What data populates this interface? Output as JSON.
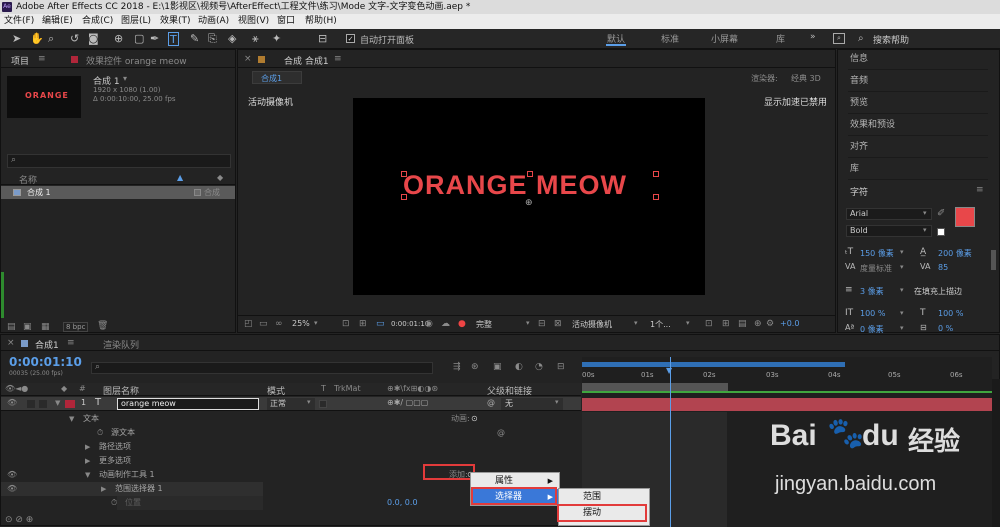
{
  "window": {
    "title": "Adobe After Effects CC 2018 - E:\\1影视区\\视频号\\AfterEffect\\工程文件\\练习\\Mode 文字-文字变色动画.aep *",
    "logo": "Ae"
  },
  "menu": [
    "文件(F)",
    "编辑(E)",
    "合成(C)",
    "图层(L)",
    "效果(T)",
    "动画(A)",
    "视图(V)",
    "窗口",
    "帮助(H)"
  ],
  "toolbar": {
    "auto_open_label": "自动打开面板",
    "search_placeholder": "搜索帮助"
  },
  "workspaces": [
    "默认",
    "标准",
    "小屏幕",
    "库"
  ],
  "project_panel": {
    "tab_project": "项目",
    "tab_effects": "效果控件 orange meow",
    "thumb_text": "ORANGE",
    "comp_name": "合成 1",
    "comp_info_1": "1920 x 1080 (1.00)",
    "comp_info_2": "Δ 0:00:10:00, 25.00 fps",
    "col_name": "名称",
    "item_name": "合成 1",
    "item_type": "合成",
    "bpc": "8 bpc"
  },
  "comp_viewer": {
    "tab": "合成 合成1",
    "breadcrumb": "合成1",
    "renderer_label": "渲染器:",
    "renderer_value": "经典 3D",
    "camera_label": "活动摄像机",
    "accel_label": "显示加速已禁用",
    "canvas_text": "ORANGE MEOW",
    "zoom": "25%",
    "timecode": "0:00:01:10",
    "quality": "完整",
    "view_camera": "活动摄像机",
    "view_count": "1个...",
    "exposure": "+0.0"
  },
  "right_panel": {
    "items": [
      "信息",
      "音频",
      "预览",
      "效果和预设",
      "对齐",
      "库"
    ],
    "char_title": "字符",
    "font": "Arial",
    "style": "Bold",
    "size": "150 像素",
    "leading": "200 像素",
    "kerning": "度量标准",
    "tracking": "85",
    "stroke_width": "3 像素",
    "stroke_mode": "在填充上描边",
    "vscale": "100 %",
    "hscale": "100 %",
    "baseline": "0 像素",
    "tsume": "0 %",
    "fill_color": "#e8474a"
  },
  "timeline": {
    "tab": "合成1",
    "render_tab": "渲染队列",
    "timecode": "0:00:01:10",
    "timecode_sub": "00035 (25.00 fps)",
    "cols": {
      "layer_name": "图层名称",
      "mode": "模式",
      "t": "T",
      "trkmat": "TrkMat",
      "parent": "父级和链接"
    },
    "ruler": [
      "00s",
      "01s",
      "02s",
      "03s",
      "04s",
      "05s",
      "06s"
    ],
    "layer": {
      "num": "1",
      "name": "orange meow",
      "mode": "正常",
      "parent": "无"
    },
    "rows": [
      "文本",
      "源文本",
      "路径选项",
      "更多选项",
      "动画制作工具 1",
      "范围选择器 1",
      "位置"
    ],
    "animate_label": "动画:",
    "add_label": "添加:",
    "position_value": "0.0, 0.0"
  },
  "context_menu": {
    "items": [
      "属性",
      "选择器"
    ],
    "sub_items": [
      "范围",
      "摆动"
    ]
  },
  "watermark": {
    "brand": "Bai",
    "brand2": "du",
    "brand3": "经验",
    "url": "jingyan.baidu.com"
  }
}
